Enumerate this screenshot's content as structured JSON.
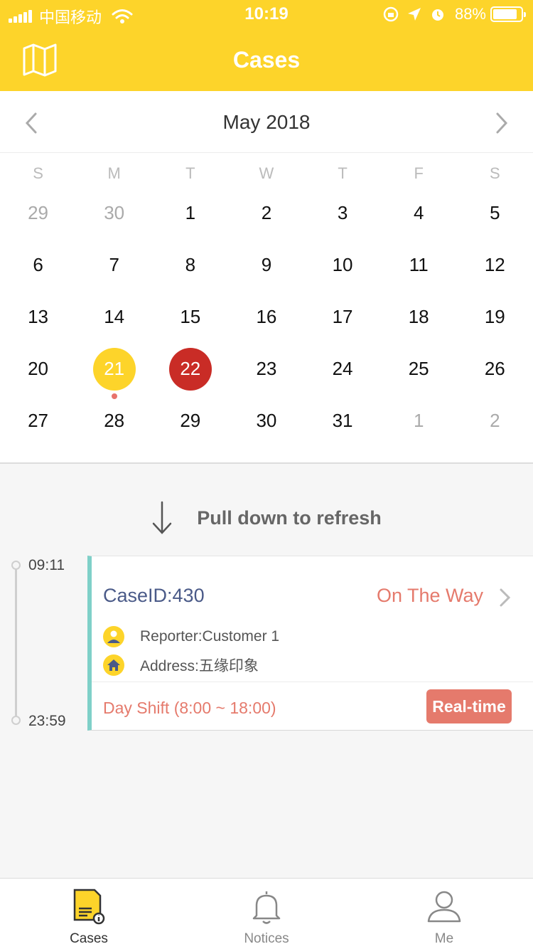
{
  "status_bar": {
    "carrier": "中国移动",
    "time": "10:19",
    "battery": "88%"
  },
  "nav": {
    "title": "Cases",
    "map_icon": "map-icon"
  },
  "calendar": {
    "month_label": "May 2018",
    "weekdays": [
      "S",
      "M",
      "T",
      "W",
      "T",
      "F",
      "S"
    ],
    "weeks": [
      [
        {
          "d": "29",
          "muted": true
        },
        {
          "d": "30",
          "muted": true
        },
        {
          "d": "1"
        },
        {
          "d": "2"
        },
        {
          "d": "3"
        },
        {
          "d": "4"
        },
        {
          "d": "5"
        }
      ],
      [
        {
          "d": "6"
        },
        {
          "d": "7"
        },
        {
          "d": "8"
        },
        {
          "d": "9"
        },
        {
          "d": "10"
        },
        {
          "d": "11"
        },
        {
          "d": "12"
        }
      ],
      [
        {
          "d": "13"
        },
        {
          "d": "14"
        },
        {
          "d": "15"
        },
        {
          "d": "16"
        },
        {
          "d": "17"
        },
        {
          "d": "18"
        },
        {
          "d": "19"
        }
      ],
      [
        {
          "d": "20"
        },
        {
          "d": "21",
          "today": true,
          "dot": true
        },
        {
          "d": "22",
          "selected": true
        },
        {
          "d": "23"
        },
        {
          "d": "24"
        },
        {
          "d": "25"
        },
        {
          "d": "26"
        }
      ],
      [
        {
          "d": "27"
        },
        {
          "d": "28"
        },
        {
          "d": "29"
        },
        {
          "d": "30"
        },
        {
          "d": "31"
        },
        {
          "d": "1",
          "muted": true
        },
        {
          "d": "2",
          "muted": true
        }
      ]
    ]
  },
  "refresh": {
    "label": "Pull down to refresh"
  },
  "timeline": {
    "start": "09:11",
    "end": "23:59"
  },
  "case": {
    "id_label": "CaseID:430",
    "status": "On The Way",
    "reporter": "Reporter:Customer 1",
    "address": "Address:五缘印象",
    "shift": "Day Shift (8:00 ~ 18:00)",
    "realtime_label": "Real-time"
  },
  "tabs": [
    {
      "label": "Cases",
      "icon": "cases-icon",
      "active": true
    },
    {
      "label": "Notices",
      "icon": "bell-icon",
      "active": false
    },
    {
      "label": "Me",
      "icon": "person-icon",
      "active": false
    }
  ],
  "colors": {
    "brand_yellow": "#fdd42a",
    "selected_red": "#c92c26",
    "status_coral": "#e57a6c",
    "case_accent": "#7fd0c8",
    "case_id_blue": "#4a5a88"
  }
}
